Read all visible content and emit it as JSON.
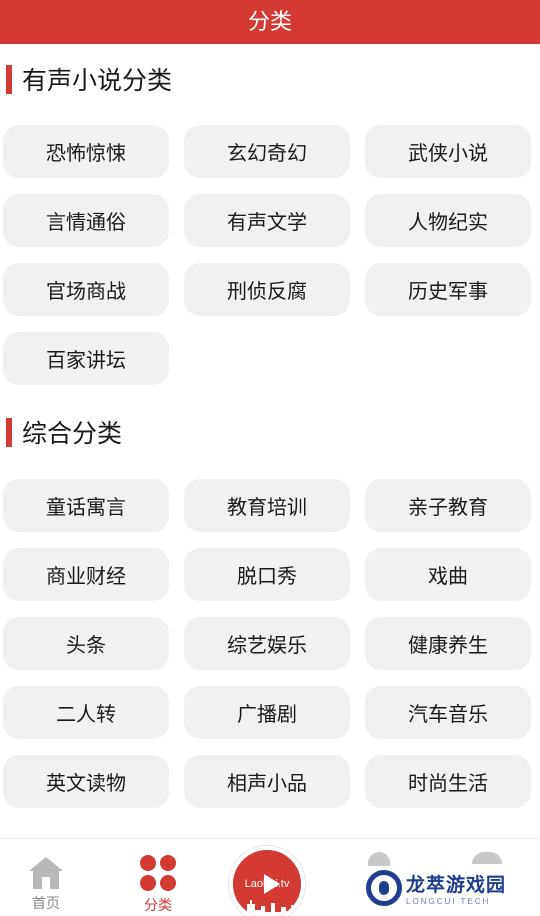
{
  "header": {
    "title": "分类"
  },
  "sections": [
    {
      "title": "有声小说分类",
      "items": [
        "恐怖惊悚",
        "玄幻奇幻",
        "武侠小说",
        "言情通俗",
        "有声文学",
        "人物纪实",
        "官场商战",
        "刑侦反腐",
        "历史军事",
        "百家讲坛"
      ]
    },
    {
      "title": "综合分类",
      "items": [
        "童话寓言",
        "教育培训",
        "亲子教育",
        "商业财经",
        "脱口秀",
        "戏曲",
        "头条",
        "综艺娱乐",
        "健康养生",
        "二人转",
        "广播剧",
        "汽车音乐",
        "英文读物",
        "相声小品",
        "时尚生活"
      ]
    }
  ],
  "tabbar": {
    "home_label": "首页",
    "category_label": "分类",
    "center_logo": "Laobai.tv"
  },
  "watermark": {
    "main": "龙萃游戏园",
    "sub": "LONGCUI TECH"
  },
  "colors": {
    "accent": "#d43a34",
    "chip_bg": "#f1f1f3"
  }
}
